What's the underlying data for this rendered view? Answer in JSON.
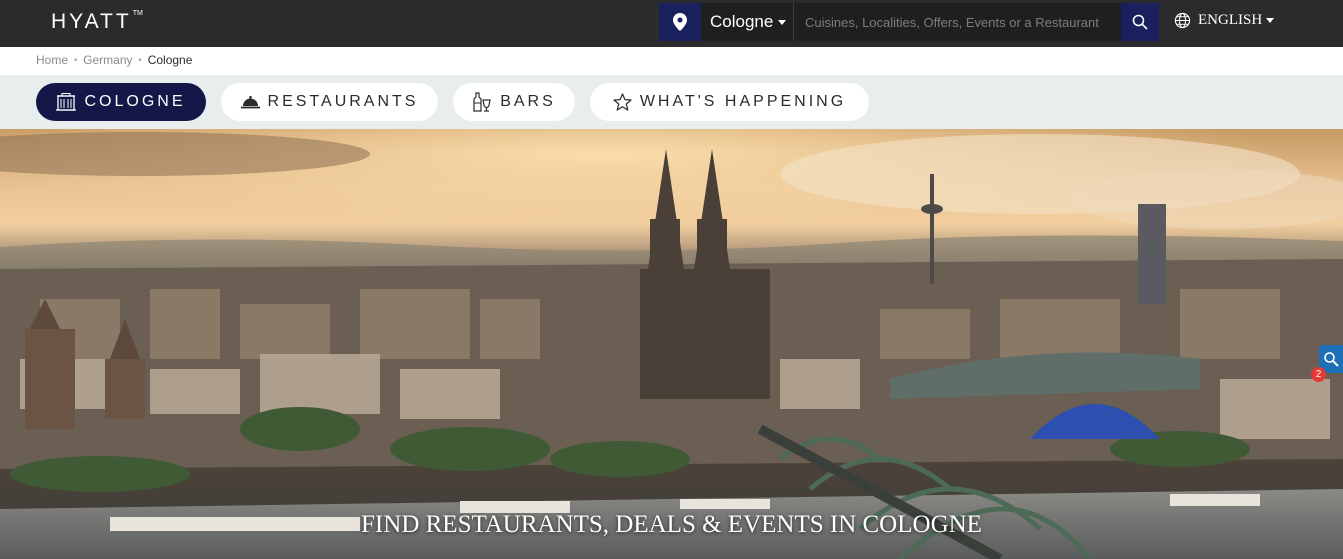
{
  "header": {
    "logo_text": "HYATT",
    "logo_tm": "TM",
    "location_icon": "map-pin-icon",
    "city": "Cologne",
    "search": {
      "placeholder": "Cuisines, Localities, Offers, Events or a Restaurant",
      "value": ""
    },
    "search_icon": "search-icon",
    "language": "ENGLISH",
    "language_icon": "globe-icon"
  },
  "breadcrumb": {
    "items": [
      "Home",
      "Germany"
    ],
    "current": "Cologne"
  },
  "tabs": [
    {
      "label": "COLOGNE",
      "icon": "building-icon",
      "active": true
    },
    {
      "label": "RESTAURANTS",
      "icon": "cloche-icon",
      "active": false
    },
    {
      "label": "BARS",
      "icon": "bottle-glass-icon",
      "active": false
    },
    {
      "label": "WHAT'S HAPPENING",
      "icon": "star-icon",
      "active": false
    }
  ],
  "hero": {
    "title": "FIND RESTAURANTS, DEALS & EVENTS IN COLOGNE",
    "image_subject": "Cologne skyline at sunset"
  },
  "floating_widget": {
    "icon": "accessibility-search-icon",
    "badge": "2"
  },
  "colors": {
    "topbar": "#2b2b2b",
    "brand_navy": "#131848",
    "search_accent": "#1a1f5e",
    "tab_strip": "#e8eeee"
  }
}
